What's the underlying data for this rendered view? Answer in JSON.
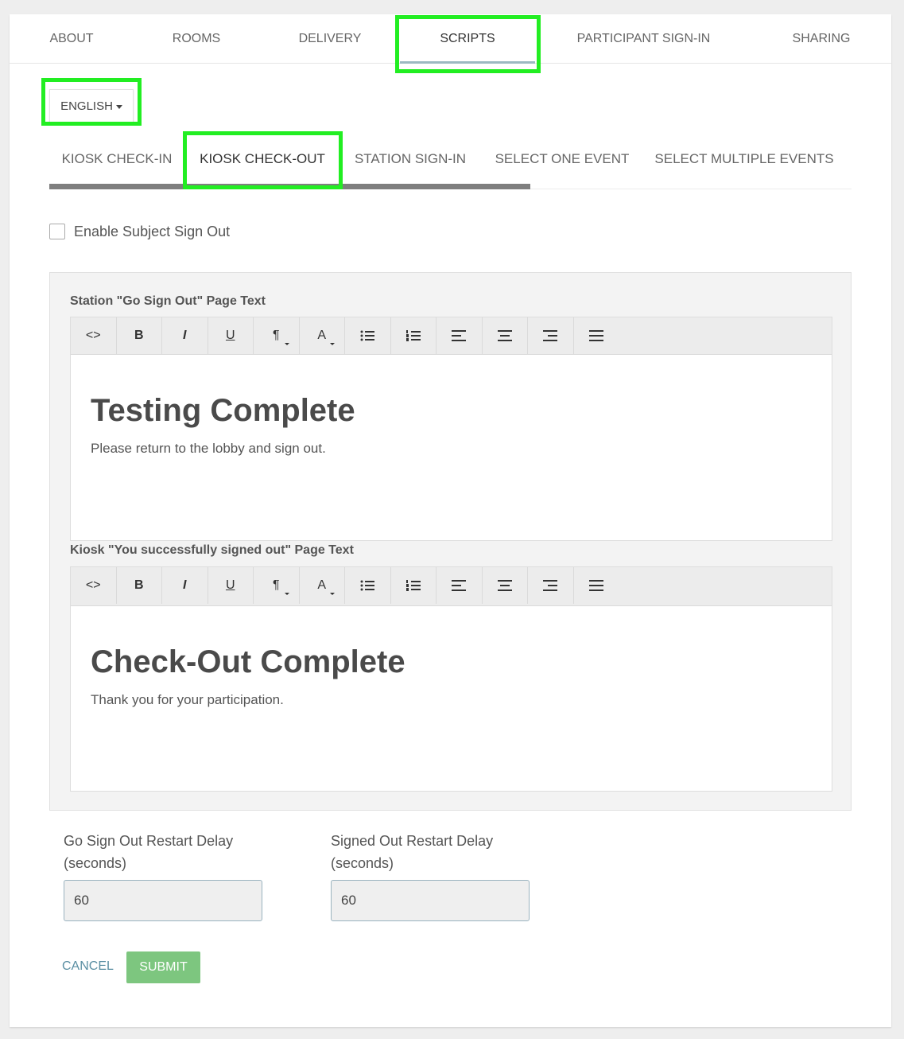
{
  "top_tabs": [
    "ABOUT",
    "ROOMS",
    "DELIVERY",
    "SCRIPTS",
    "PARTICIPANT SIGN-IN",
    "SHARING"
  ],
  "active_top_tab": "SCRIPTS",
  "language": {
    "selected": "ENGLISH"
  },
  "sub_tabs": [
    "KIOSK CHECK-IN",
    "KIOSK CHECK-OUT",
    "STATION SIGN-IN",
    "SELECT ONE EVENT",
    "SELECT MULTIPLE EVENTS"
  ],
  "active_sub_tab": "KIOSK CHECK-OUT",
  "enable_sign_out": {
    "label": "Enable Subject Sign Out",
    "checked": false
  },
  "toolbar": {
    "code": "<>",
    "bold": "B",
    "italic": "I",
    "underline": "U",
    "paragraph": "¶",
    "font_color": "A",
    "icons": [
      "code-view-icon",
      "bold-icon",
      "italic-icon",
      "underline-icon",
      "paragraph-icon",
      "font-color-icon",
      "unordered-list-icon",
      "ordered-list-icon",
      "align-left-icon",
      "align-center-icon",
      "align-right-icon",
      "justify-icon"
    ]
  },
  "editors": [
    {
      "label": "Station \"Go Sign Out\" Page Text",
      "heading": "Testing Complete",
      "body": "Please return to the lobby and sign out."
    },
    {
      "label": "Kiosk \"You successfully signed out\" Page Text",
      "heading": "Check-Out Complete",
      "body": "Thank you for your participation."
    }
  ],
  "delays": [
    {
      "label_line1": "Go Sign Out Restart Delay",
      "label_line2": "(seconds)",
      "value": "60"
    },
    {
      "label_line1": "Signed Out Restart Delay",
      "label_line2": "(seconds)",
      "value": "60"
    }
  ],
  "buttons": {
    "cancel": "CANCEL",
    "submit": "SUBMIT"
  },
  "colors": {
    "highlight": "#22ee22",
    "submit": "#7dc67f",
    "cancel": "#5b8fa3",
    "active_tab_underline": "#9cb9c2"
  }
}
